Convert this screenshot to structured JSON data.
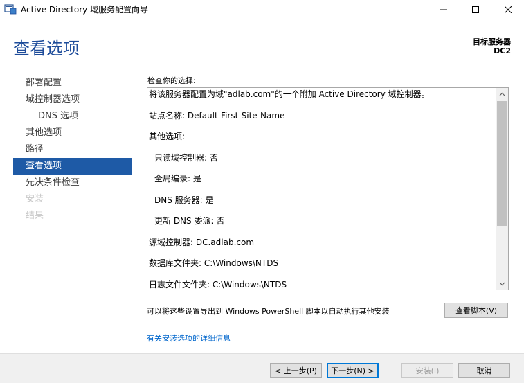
{
  "window": {
    "title": "Active Directory 域服务配置向导"
  },
  "header": {
    "page_title": "查看选项",
    "target_label": "目标服务器",
    "target_server": "DC2"
  },
  "nav": {
    "items": [
      {
        "label": "部署配置",
        "state": "normal"
      },
      {
        "label": "域控制器选项",
        "state": "normal"
      },
      {
        "label": "DNS 选项",
        "state": "sub"
      },
      {
        "label": "其他选项",
        "state": "normal"
      },
      {
        "label": "路径",
        "state": "normal"
      },
      {
        "label": "查看选项",
        "state": "active"
      },
      {
        "label": "先决条件检查",
        "state": "normal"
      },
      {
        "label": "安装",
        "state": "disabled"
      },
      {
        "label": "结果",
        "state": "disabled"
      }
    ]
  },
  "review": {
    "label": "检查你的选择:",
    "lines": [
      "将该服务器配置为域\"adlab.com\"的一个附加 Active Directory 域控制器。",
      "站点名称: Default-First-Site-Name",
      "其他选项:",
      "只读域控制器: 否",
      "全局编录: 是",
      "DNS 服务器: 是",
      "更新 DNS 委派: 否",
      "源域控制器: DC.adlab.com",
      "数据库文件夹: C:\\Windows\\NTDS",
      "日志文件文件夹: C:\\Windows\\NTDS"
    ]
  },
  "export": {
    "text": "可以将这些设置导出到 Windows PowerShell 脚本以自动执行其他安装",
    "button": "查看脚本(V)"
  },
  "more_link": "有关安装选项的详细信息",
  "footer": {
    "prev": "< 上一步(P)",
    "next": "下一步(N) >",
    "install": "安装(I)",
    "cancel": "取消"
  },
  "colors": {
    "accent": "#1e4c9a",
    "nav_active": "#1e5aa6",
    "link": "#0066cc"
  }
}
